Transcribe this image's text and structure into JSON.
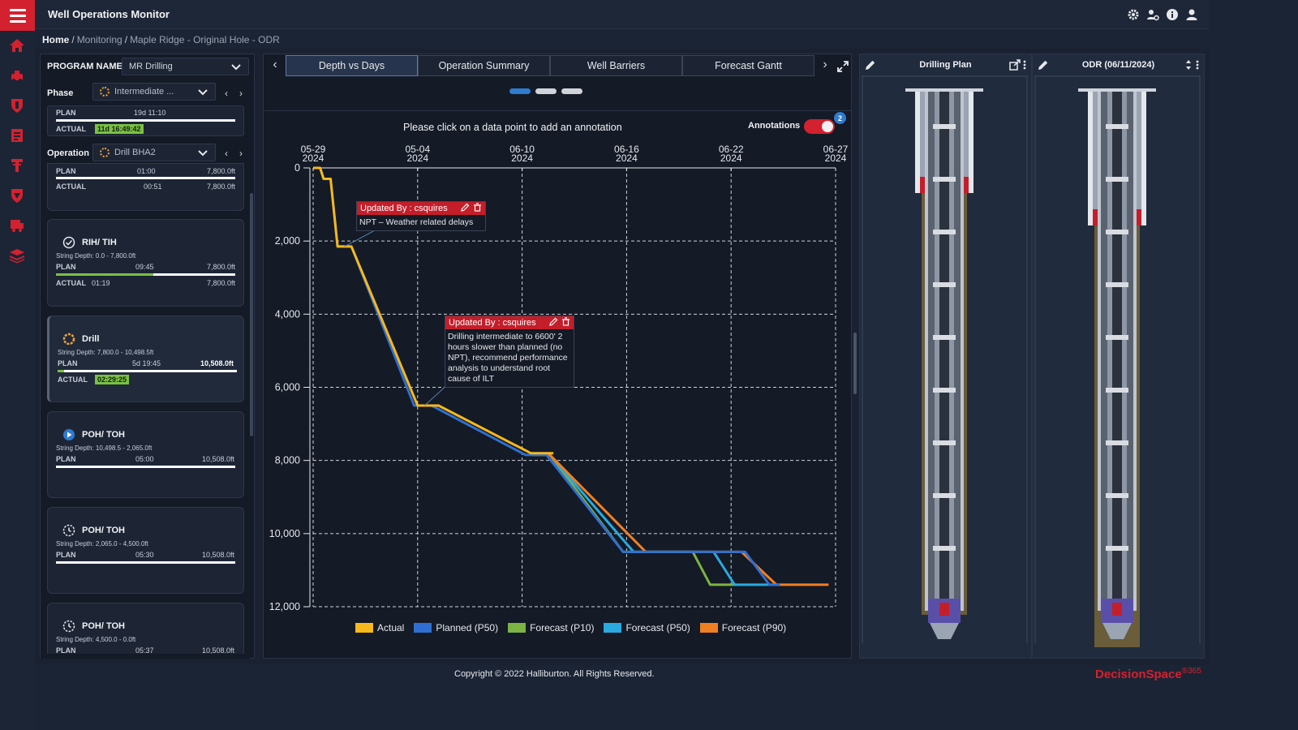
{
  "app": {
    "title": "Well Operations Monitor"
  },
  "breadcrumb": {
    "home": "Home",
    "sep": "/",
    "monitoring": "Monitoring",
    "well": "Maple Ridge - Original Hole - ODR"
  },
  "left": {
    "program_label": "PROGRAM NAME",
    "program_value": "MR Drilling",
    "phase_label": "Phase",
    "phase_value": "Intermediate ...",
    "phase_plan_label": "PLAN",
    "phase_plan_value": "19d 11:10",
    "phase_actual_label": "ACTUAL",
    "phase_actual_value": "11d 16:49:42",
    "operation_label": "Operation",
    "operation_value": "Drill BHA2",
    "partial_card": {
      "plan_label": "PLAN",
      "plan_time": "01:00",
      "plan_depth": "7,800.0ft",
      "actual_label": "ACTUAL",
      "actual_time": "00:51",
      "actual_depth": "7,800.0ft"
    },
    "cards": [
      {
        "title": "RIH/ TIH",
        "string_depth": "String Depth: 0.0 - 7,800.0ft",
        "plan_label": "PLAN",
        "plan_time": "09:45",
        "plan_depth": "7,800.0ft",
        "actual_label": "ACTUAL",
        "actual_time": "01:19",
        "actual_depth": "7,800.0ft"
      },
      {
        "title": "Drill",
        "string_depth": "String Depth: 7,800.0 - 10,498.5ft",
        "plan_label": "PLAN",
        "plan_time": "5d 19:45",
        "plan_depth": "10,508.0ft",
        "actual_label": "ACTUAL",
        "actual_time": "02:29:25"
      },
      {
        "title": "POH/ TOH",
        "string_depth": "String Depth: 10,498.5 - 2,065.0ft",
        "plan_label": "PLAN",
        "plan_time": "05:00",
        "plan_depth": "10,508.0ft"
      },
      {
        "title": "POH/ TOH",
        "string_depth": "String Depth: 2,065.0 - 4,500.0ft",
        "plan_label": "PLAN",
        "plan_time": "05:30",
        "plan_depth": "10,508.0ft"
      },
      {
        "title": "POH/ TOH",
        "string_depth": "String Depth: 4,500.0 - 0.0ft",
        "plan_label": "PLAN",
        "plan_time": "05:37",
        "plan_depth": "10,508.0ft"
      }
    ]
  },
  "center": {
    "tabs": [
      "Depth vs Days",
      "Operation Summary",
      "Well Barriers",
      "Forecast Gantt"
    ],
    "active_tab": 0,
    "hint": "Please click on a data point to add an annotation",
    "annotations_label": "Annotations",
    "annotations_count": "2",
    "annotation1": {
      "header": "Updated By : csquires",
      "text": "NPT – Weather related delays"
    },
    "annotation2": {
      "header": "Updated By : csquires",
      "text": "Drilling intermediate to 6600' 2 hours slower than planned (no NPT), recommend performance analysis to understand root cause of ILT"
    }
  },
  "chart_data": {
    "type": "line",
    "x_dates": [
      "05-29 2024",
      "05-04 2024",
      "06-10 2024",
      "06-16 2024",
      "06-22 2024",
      "06-27 2024"
    ],
    "x_ticks": [
      {
        "top": "05-29",
        "bottom": "2024"
      },
      {
        "top": "05-04",
        "bottom": "2024"
      },
      {
        "top": "06-10",
        "bottom": "2024"
      },
      {
        "top": "06-16",
        "bottom": "2024"
      },
      {
        "top": "06-22",
        "bottom": "2024"
      },
      {
        "top": "06-27",
        "bottom": "2024"
      }
    ],
    "y_ticks": [
      "0",
      "2,000",
      "4,000",
      "6,000",
      "8,000",
      "10,000",
      "12,000"
    ],
    "ylim": [
      0,
      12000
    ],
    "y_inverted": true,
    "grid": true,
    "legend_placement": "bottom",
    "series": [
      {
        "name": "Actual",
        "color": "#f6b81b",
        "points": [
          [
            0,
            0
          ],
          [
            0.4,
            0
          ],
          [
            0.6,
            300
          ],
          [
            1.0,
            300
          ],
          [
            1.4,
            2150
          ],
          [
            2.2,
            2150
          ],
          [
            6.0,
            6500
          ],
          [
            7.2,
            6500
          ],
          [
            12.5,
            7800
          ],
          [
            13.8,
            7800
          ]
        ]
      },
      {
        "name": "Planned (P50)",
        "color": "#2f6fd1",
        "points": [
          [
            0,
            0
          ],
          [
            0.4,
            0
          ],
          [
            0.6,
            300
          ],
          [
            1.0,
            300
          ],
          [
            1.4,
            2150
          ],
          [
            2.2,
            2150
          ],
          [
            5.8,
            6500
          ],
          [
            6.8,
            6500
          ],
          [
            12.2,
            7850
          ],
          [
            13.4,
            7850
          ],
          [
            17.8,
            10500
          ],
          [
            24.8,
            10500
          ],
          [
            26.2,
            11400
          ],
          [
            26.8,
            11400
          ]
        ]
      },
      {
        "name": "Forecast (P10)",
        "color": "#7cb342",
        "points": [
          [
            12.6,
            7850
          ],
          [
            13.6,
            7850
          ],
          [
            17.8,
            10500
          ],
          [
            21.8,
            10500
          ],
          [
            22.8,
            11400
          ],
          [
            24.3,
            11400
          ]
        ]
      },
      {
        "name": "Forecast (P50)",
        "color": "#29a9e0",
        "points": [
          [
            12.6,
            7850
          ],
          [
            13.6,
            7850
          ],
          [
            18.4,
            10500
          ],
          [
            23.0,
            10500
          ],
          [
            24.2,
            11400
          ],
          [
            26.8,
            11400
          ]
        ]
      },
      {
        "name": "Forecast (P90)",
        "color": "#f07f22",
        "points": [
          [
            12.6,
            7850
          ],
          [
            13.6,
            7850
          ],
          [
            19.1,
            10500
          ],
          [
            24.6,
            10500
          ],
          [
            26.6,
            11400
          ],
          [
            29.6,
            11400
          ]
        ]
      }
    ]
  },
  "wells": [
    {
      "title": "Drilling Plan"
    },
    {
      "title": "ODR (06/11/2024)"
    }
  ],
  "footer": {
    "copyright": "Copyright © 2022 Halliburton. All Rights Reserved.",
    "brand": "DecisionSpace",
    "brand_sup": "®365"
  },
  "colors": {
    "accent": "#d4212f",
    "actual_tag": "#7ac143",
    "selected_tab": "#5b7bb0"
  }
}
